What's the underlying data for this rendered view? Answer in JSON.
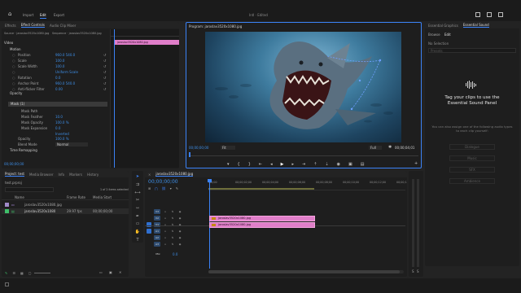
{
  "app": {
    "topnav": {
      "home": "⌂",
      "import": "Import",
      "edit": "Edit",
      "export": "Export"
    },
    "center_title": "Intl · Edited"
  },
  "effect_controls": {
    "tabs": [
      "Effects",
      "Effect Controls",
      "Audio Clip Mixer"
    ],
    "source_label": "Source · jaroslav3520x1080.jpg",
    "seq_label": "Sequence · jaroslav3520x1080.jpg",
    "clip_label": "jaroslav3520x1080.jpg",
    "video_header": "Video",
    "motion": "Motion",
    "props": [
      {
        "name": "Position",
        "value": "960.0  540.0"
      },
      {
        "name": "Scale",
        "value": "100.0"
      },
      {
        "name": "Scale Width",
        "value": "100.0"
      },
      {
        "name": "",
        "value": "Uniform Scale"
      },
      {
        "name": "Rotation",
        "value": "0.0"
      },
      {
        "name": "Anchor Point",
        "value": "960.0  540.0"
      },
      {
        "name": "Anti-flicker Filter",
        "value": "0.00"
      }
    ],
    "opacity": "Opacity",
    "mask": "Mask (1)",
    "mask_props": [
      {
        "name": "Mask Path",
        "value": ""
      },
      {
        "name": "Mask Feather",
        "value": "10.0"
      },
      {
        "name": "Mask Opacity",
        "value": "100.0 %"
      },
      {
        "name": "Mask Expansion",
        "value": "0.0"
      },
      {
        "name": "",
        "value": "Inverted"
      }
    ],
    "opacity_row": {
      "name": "Opacity",
      "value": "100.0 %"
    },
    "blend_row": {
      "name": "Blend Mode",
      "value": "Normal"
    },
    "time_remap": "Time Remapping",
    "timecode": "00;00;00;00"
  },
  "program": {
    "title": "Program: jaroslav3520x1080.jpg",
    "timecode": "00;00;00;00",
    "fit": "Fit",
    "quality": "Full",
    "duration": "00;00;04;01"
  },
  "essential_sound": {
    "tabs": [
      "Essential Graphics",
      "Essential Sound"
    ],
    "subtabs": [
      "Browse",
      "Edit"
    ],
    "no_selection": "No Selection",
    "search_placeholder": "Presets",
    "heading": "Tag your clips to use the Essential Sound Panel",
    "body": "You can also assign one of the following audio types to each clip yourself:",
    "types": [
      "Dialogue",
      "Music",
      "SFX",
      "Ambience"
    ]
  },
  "project": {
    "tabs": [
      "Project: test",
      "Media Browser",
      "Info",
      "Markers",
      "History"
    ],
    "bin": "test.prproj",
    "items_count": "1 of 2 items selected",
    "columns": [
      "Name",
      "Frame Rate",
      "Media Start"
    ],
    "rows": [
      {
        "name": "jaroslav3520x1080.jpg",
        "rate": "",
        "start": "",
        "color": "#a08ac8"
      },
      {
        "name": "jaroslav3520x1080",
        "rate": "29.97 fps",
        "start": "00;00;00;00",
        "color": "#3fbf6a"
      }
    ]
  },
  "timeline": {
    "tab": "jaroslav3520x1080.jpg",
    "timecode": "00;00;00;00",
    "ruler": [
      ":00;00",
      "00;00;02;00",
      "00;00;04;00",
      "00;00;06;00",
      "00;00;08;00",
      "00;00;10;00",
      "00;00;12;00",
      "00;00;14;00"
    ],
    "tracks": [
      "V3",
      "V2",
      "V1",
      "A1",
      "A2",
      "A3",
      "Mix"
    ],
    "clips": [
      {
        "label": "jaroslav3520x1080.jpg"
      },
      {
        "label": "jaroslav3520x1080.jpg"
      }
    ],
    "mix_value": "0.0",
    "meter_labels": [
      "S",
      "S"
    ]
  }
}
